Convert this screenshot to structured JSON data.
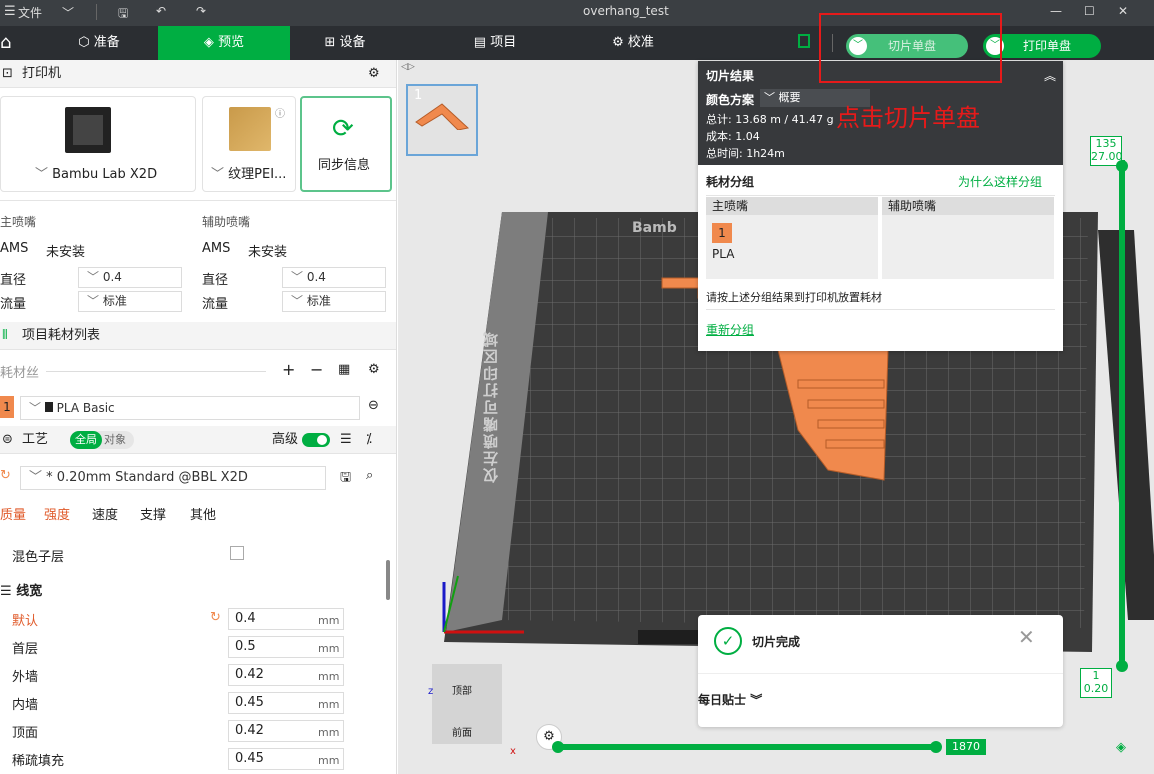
{
  "titlebar": {
    "menu_label": "文件",
    "title": "overhang_test",
    "min": "—",
    "max": "☐",
    "close": "✕"
  },
  "nav": {
    "tabs": [
      {
        "label": "准备"
      },
      {
        "label": "预览"
      },
      {
        "label": "设备"
      },
      {
        "label": "项目"
      },
      {
        "label": "校准"
      }
    ],
    "slice_button": "切片单盘",
    "print_button": "打印单盘"
  },
  "printer": {
    "section_title": "打印机",
    "name": "Bambu Lab X2D",
    "plate": "纹理PEI...",
    "sync_label": "同步信息",
    "main_nozzle": {
      "title": "主喷嘴",
      "ams_label": "AMS",
      "ams_value": "未安装",
      "diameter_label": "直径",
      "diameter": "0.4",
      "flow_label": "流量",
      "flow": "标准"
    },
    "aux_nozzle": {
      "title": "辅助喷嘴",
      "ams_label": "AMS",
      "ams_value": "未安装",
      "diameter_label": "直径",
      "diameter": "0.4",
      "flow_label": "流量",
      "flow": "标准"
    }
  },
  "filament": {
    "section_title": "项目耗材列表",
    "label": "耗材丝",
    "item_index": "1",
    "item_name": "PLA Basic"
  },
  "process": {
    "section_title": "工艺",
    "global_tag": "全局",
    "object_tag": "对象",
    "advanced_label": "高级",
    "preset": "* 0.20mm Standard @BBL X2D",
    "tabs": [
      "质量",
      "强度",
      "速度",
      "支撑",
      "其他"
    ],
    "mix_label": "混色子层",
    "group_title": "线宽",
    "rows": [
      {
        "label": "默认",
        "value": "0.4",
        "unit": "mm"
      },
      {
        "label": "首层",
        "value": "0.5",
        "unit": "mm"
      },
      {
        "label": "外墙",
        "value": "0.42",
        "unit": "mm"
      },
      {
        "label": "内墙",
        "value": "0.45",
        "unit": "mm"
      },
      {
        "label": "顶面",
        "value": "0.42",
        "unit": "mm"
      },
      {
        "label": "稀疏填充",
        "value": "0.45",
        "unit": "mm"
      }
    ]
  },
  "thumbnail": {
    "index": "1"
  },
  "bed": {
    "left_only_text": "仅左喷嘴可打印区域",
    "brand": "Bamb"
  },
  "slice_result": {
    "title": "切片结果",
    "color_scheme_label": "颜色方案",
    "color_scheme_value": "概要",
    "total": "总计: 13.68 m / 41.47 g",
    "cost": "成本: 1.04",
    "time": "总时间: 1h24m",
    "group_title": "耗材分组",
    "why_link": "为什么这样分组",
    "main_nozzle": "主喷嘴",
    "aux_nozzle": "辅助喷嘴",
    "chip_index": "1",
    "chip_material": "PLA",
    "instruction": "请按上述分组结果到打印机放置耗材",
    "regroup": "重新分组"
  },
  "annotation": "点击切片单盘",
  "toast": {
    "title": "切片完成",
    "tips": "每日贴士"
  },
  "vslider": {
    "top_layer": "135",
    "top_height": "27.00",
    "bottom_layer": "1",
    "bottom_height": "0.20"
  },
  "hslider": {
    "value": "1870"
  },
  "view_cube": {
    "top": "顶部",
    "front": "前面",
    "z": "z",
    "x": "x"
  },
  "colors": {
    "accent": "#00ae42",
    "filament": "#f0894d",
    "annotation": "#e61a1a"
  }
}
